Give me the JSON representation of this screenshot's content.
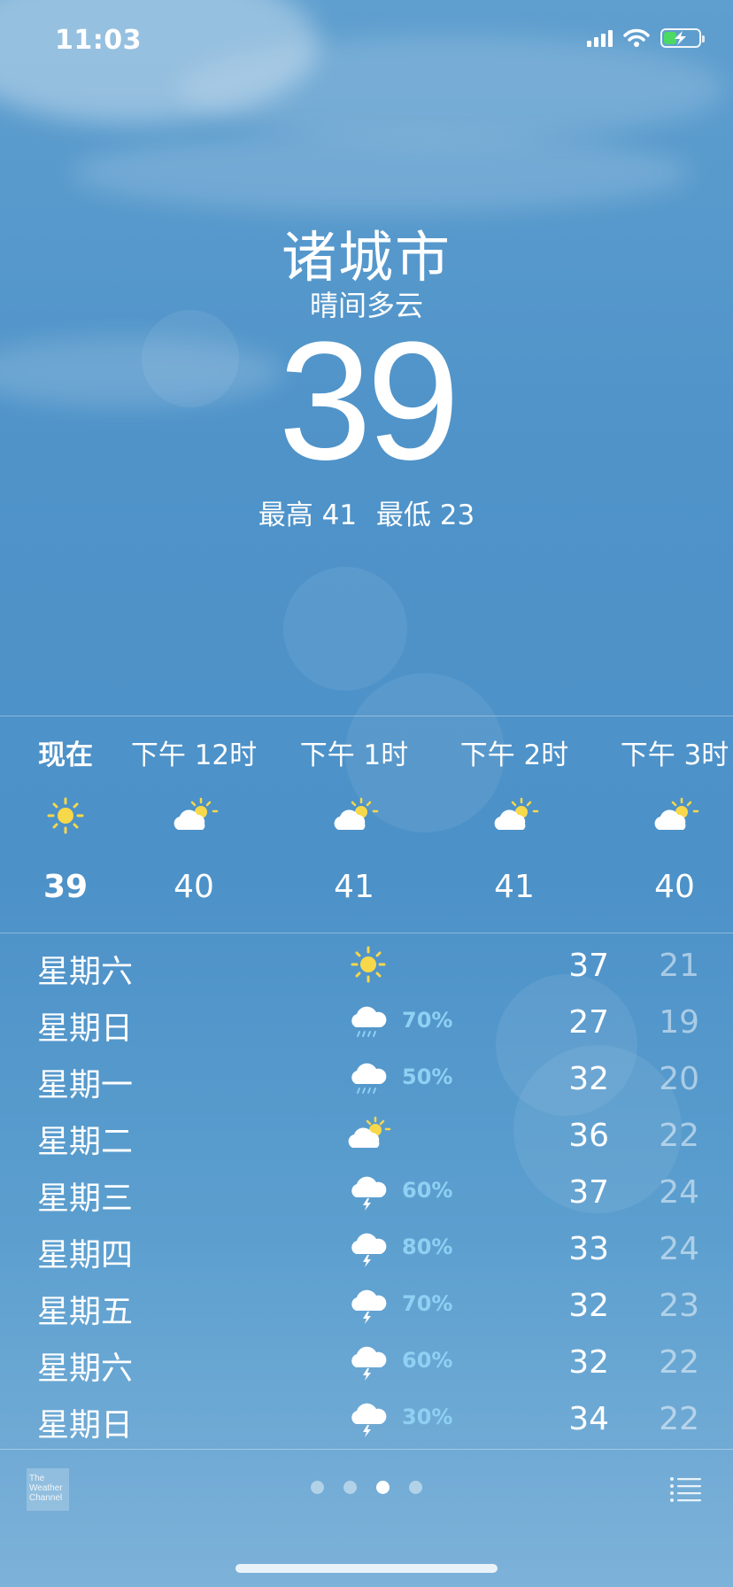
{
  "status_bar": {
    "time": "11:03"
  },
  "location": {
    "city": "诸城市",
    "condition": "晴间多云",
    "current_temp": "39",
    "high_label": "最高",
    "high": "41",
    "low_label": "最低",
    "low": "23"
  },
  "hourly": [
    {
      "time": "现在",
      "icon": "sun-icon",
      "temp": "39"
    },
    {
      "time": "下午 12时",
      "icon": "partly-cloudy-icon",
      "temp": "40"
    },
    {
      "time": "下午 1时",
      "icon": "partly-cloudy-icon",
      "temp": "41"
    },
    {
      "time": "下午 2时",
      "icon": "partly-cloudy-icon",
      "temp": "41"
    },
    {
      "time": "下午 3时",
      "icon": "partly-cloudy-icon",
      "temp": "40"
    }
  ],
  "daily": [
    {
      "day": "星期六",
      "icon": "sun-icon",
      "pop": "",
      "high": "37",
      "low": "21"
    },
    {
      "day": "星期日",
      "icon": "rain-icon",
      "pop": "70%",
      "high": "27",
      "low": "19"
    },
    {
      "day": "星期一",
      "icon": "rain-icon",
      "pop": "50%",
      "high": "32",
      "low": "20"
    },
    {
      "day": "星期二",
      "icon": "partly-cloudy-icon",
      "pop": "",
      "high": "36",
      "low": "22"
    },
    {
      "day": "星期三",
      "icon": "thunderstorm-icon",
      "pop": "60%",
      "high": "37",
      "low": "24"
    },
    {
      "day": "星期四",
      "icon": "thunderstorm-icon",
      "pop": "80%",
      "high": "33",
      "low": "24"
    },
    {
      "day": "星期五",
      "icon": "thunderstorm-icon",
      "pop": "70%",
      "high": "32",
      "low": "23"
    },
    {
      "day": "星期六",
      "icon": "thunderstorm-icon",
      "pop": "60%",
      "high": "32",
      "low": "22"
    },
    {
      "day": "星期日",
      "icon": "thunderstorm-icon",
      "pop": "30%",
      "high": "34",
      "low": "22"
    }
  ],
  "footer": {
    "logo_line1": "The",
    "logo_line2": "Weather",
    "logo_line3": "Channel",
    "page_count": 4,
    "active_page": 3
  },
  "colors": {
    "sun": "#f7d84a",
    "pop_text": "#8fd0f3",
    "battery": "#4cd964"
  }
}
